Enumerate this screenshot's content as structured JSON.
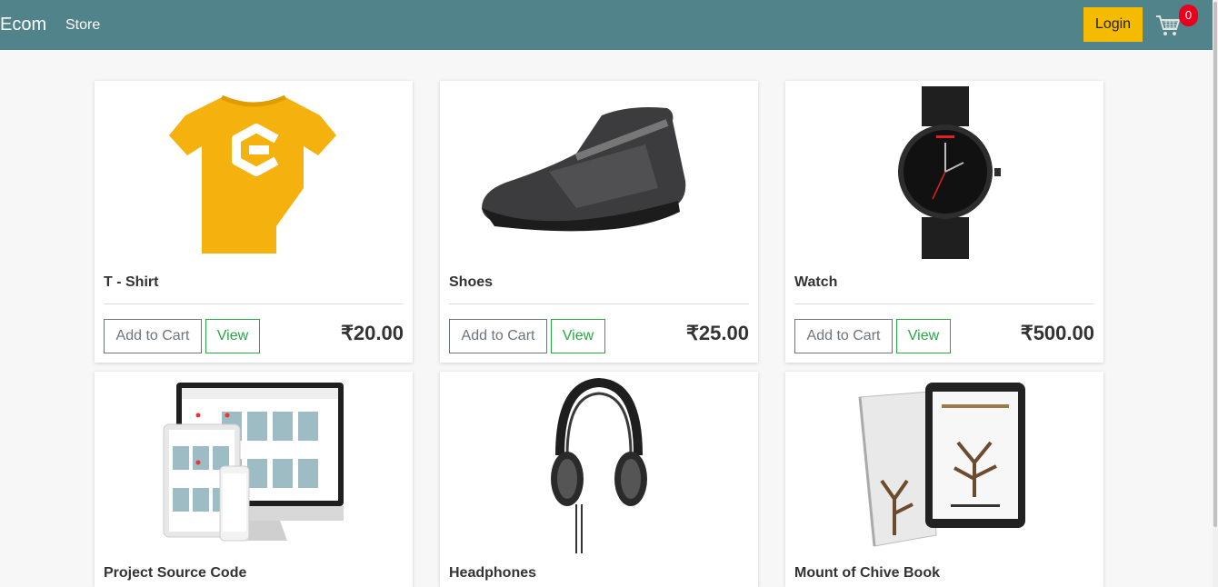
{
  "nav": {
    "brand": "Ecom",
    "store": "Store",
    "login": "Login",
    "cart_count": "0"
  },
  "products": [
    {
      "name": "T - Shirt",
      "price": "₹20.00",
      "add_label": "Add to Cart",
      "view_label": "View"
    },
    {
      "name": "Shoes",
      "price": "₹25.00",
      "add_label": "Add to Cart",
      "view_label": "View"
    },
    {
      "name": "Watch",
      "price": "₹500.00",
      "add_label": "Add to Cart",
      "view_label": "View"
    },
    {
      "name": "Project Source Code"
    },
    {
      "name": "Headphones"
    },
    {
      "name": "Mount of Chive Book"
    }
  ],
  "colors": {
    "navbar": "#50838a",
    "login": "#f5bb00",
    "badge": "#e8001c",
    "view": "#28a745",
    "add": "#6c757d"
  }
}
